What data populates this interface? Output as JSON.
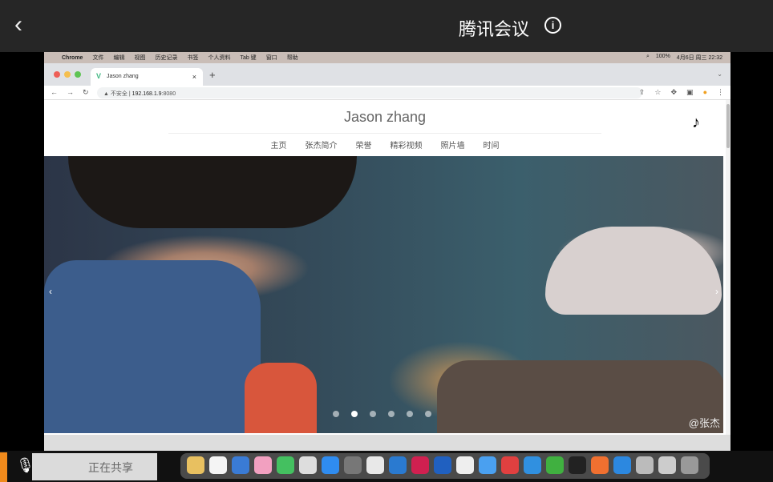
{
  "meeting": {
    "title": "腾讯会议",
    "back_icon": "chevron-left-icon",
    "info_icon": "info-icon"
  },
  "macmenu": {
    "items": [
      "Chrome",
      "文件",
      "编辑",
      "视图",
      "历史记录",
      "书签",
      "个人资料",
      "Tab 键",
      "窗口",
      "帮助"
    ],
    "battery": "100%",
    "datetime": "4月6日 周三 22:32"
  },
  "browser": {
    "tab_title": "Jason zhang",
    "close": "×",
    "new_tab": "+",
    "security": "不安全",
    "url_host": "192.168.1.9",
    "url_port": ":8080"
  },
  "site": {
    "title": "Jason zhang",
    "nav": [
      "主页",
      "张杰简介",
      "荣誉",
      "精彩视频",
      "照片墙",
      "时间"
    ],
    "music_icon": "♪"
  },
  "carousel": {
    "slides": 6,
    "active_index": 1,
    "watermark": "@张杰",
    "prev": "‹",
    "next": "›"
  },
  "bottom": {
    "share_text": "正在共享"
  },
  "colors": {
    "accent_vue": "#41b883",
    "topbar": "#262626",
    "share_orange": "#f08a1c"
  }
}
